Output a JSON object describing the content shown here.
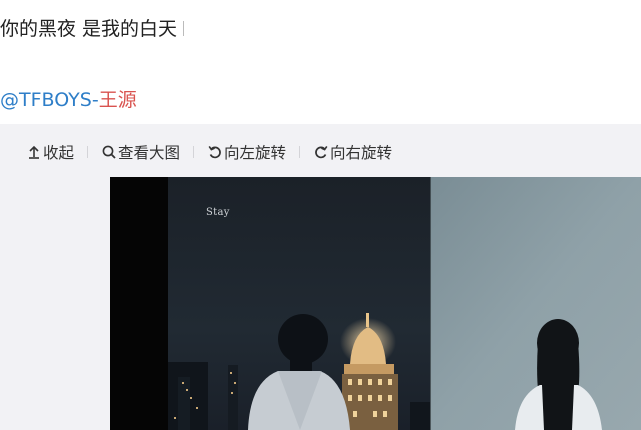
{
  "post": {
    "text": "你的黑夜 是我的白天"
  },
  "mention": {
    "handle": "@TFBOYS-",
    "name": "王源"
  },
  "toolbar": {
    "collapse_label": "收起",
    "view_large_label": "查看大图",
    "rotate_left_label": "向左旋转",
    "rotate_right_label": "向右旋转"
  },
  "image": {
    "overlay_text": "Stay"
  },
  "colors": {
    "mention_handle": "#2e7ec8",
    "mention_name": "#d9534f",
    "panel_bg": "#f2f2f5"
  }
}
